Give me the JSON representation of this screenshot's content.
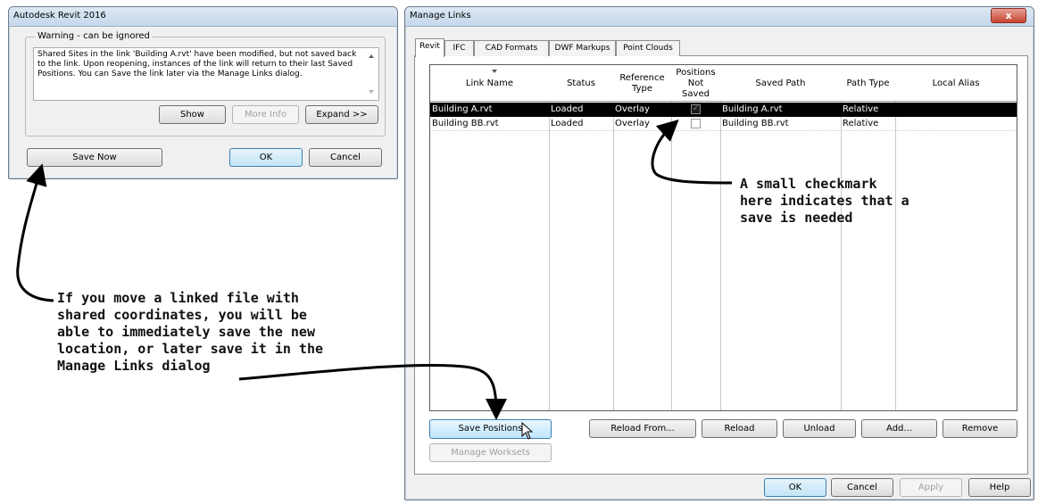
{
  "warning_window": {
    "title": "Autodesk Revit 2016",
    "group_label": "Warning - can be ignored",
    "message": "Shared Sites in the link 'Building A.rvt' have been modified, but not saved back to the link. Upon reopening, instances of the link will return to their last Saved Positions. You can Save the link later via the Manage Links dialog.",
    "buttons": {
      "show": "Show",
      "more_info": "More Info",
      "expand": "Expand >>",
      "save_now": "Save Now",
      "ok": "OK",
      "cancel": "Cancel"
    }
  },
  "manage_links": {
    "title": "Manage Links",
    "close_label": "x",
    "tabs": [
      "Revit",
      "IFC",
      "CAD Formats",
      "DWF Markups",
      "Point Clouds"
    ],
    "active_tab": "Revit",
    "columns": [
      "Link Name",
      "Status",
      "Reference Type",
      "Positions Not Saved",
      "Saved Path",
      "Path Type",
      "Local Alias"
    ],
    "rows": [
      {
        "name": "Building A.rvt",
        "status": "Loaded",
        "reference_type": "Overlay",
        "positions_not_saved": true,
        "saved_path": "Building A.rvt",
        "path_type": "Relative",
        "local_alias": "",
        "selected": true
      },
      {
        "name": "Building BB.rvt",
        "status": "Loaded",
        "reference_type": "Overlay",
        "positions_not_saved": false,
        "saved_path": "Building BB.rvt",
        "path_type": "Relative",
        "local_alias": "",
        "selected": false
      }
    ],
    "buttons": {
      "save_positions": "Save Positions",
      "manage_worksets": "Manage Worksets",
      "reload_from": "Reload From...",
      "reload": "Reload",
      "unload": "Unload",
      "add": "Add...",
      "remove": "Remove",
      "ok": "OK",
      "cancel": "Cancel",
      "apply": "Apply",
      "help": "Help"
    }
  },
  "annotations": {
    "left": "If you move a linked file with\nshared coordinates, you will be\nable to immediately save the new\nlocation, or later save it in the\nManage Links dialog",
    "right": "A small checkmark\nhere indicates that a\nsave is needed"
  }
}
